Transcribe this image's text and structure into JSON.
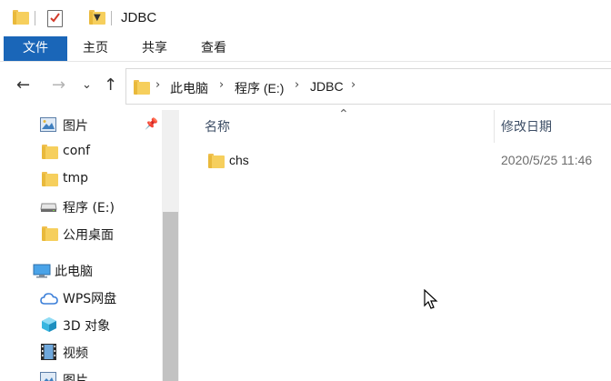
{
  "title": {
    "window_title": "JDBC"
  },
  "ribbon": {
    "tabs": [
      {
        "label": "文件"
      },
      {
        "label": "主页"
      },
      {
        "label": "共享"
      },
      {
        "label": "查看"
      }
    ]
  },
  "address": {
    "crumbs": [
      "此电脑",
      "程序 (E:)",
      "JDBC"
    ]
  },
  "nav": {
    "items": [
      {
        "label": "图片",
        "icon": "pictures-icon",
        "pinned": true
      },
      {
        "label": "conf",
        "icon": "folder-icon"
      },
      {
        "label": "tmp",
        "icon": "folder-icon"
      },
      {
        "label": "程序 (E:)",
        "icon": "drive-icon"
      },
      {
        "label": "公用桌面",
        "icon": "folder-icon"
      },
      {
        "label": "此电脑",
        "icon": "computer-icon"
      },
      {
        "label": "WPS网盘",
        "icon": "cloud-icon"
      },
      {
        "label": "3D 对象",
        "icon": "3d-objects-icon"
      },
      {
        "label": "视频",
        "icon": "video-icon"
      },
      {
        "label": "图片",
        "icon": "pictures-icon"
      }
    ]
  },
  "file_list": {
    "columns": {
      "name": "名称",
      "modified": "修改日期"
    },
    "rows": [
      {
        "name": "chs",
        "modified": "2020/5/25 11:46",
        "icon": "folder-icon"
      }
    ]
  },
  "colors": {
    "accent": "#1a66b8",
    "folder": "#f6cf5d"
  }
}
